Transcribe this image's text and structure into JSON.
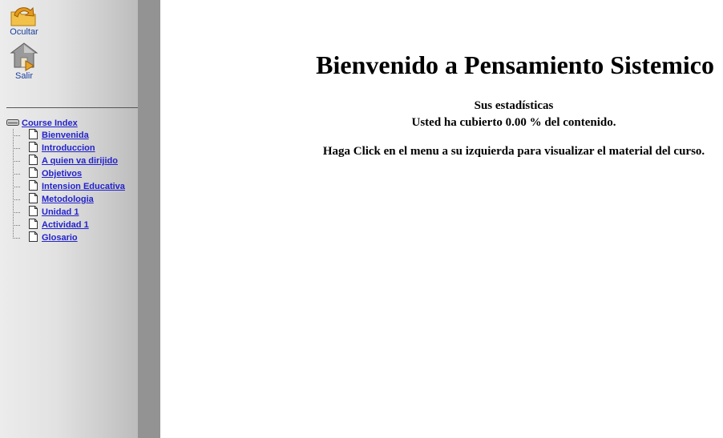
{
  "sidebar": {
    "tools": {
      "hide_label": "Ocultar",
      "exit_label": "Salir"
    },
    "tree": {
      "root_label": "Course Index",
      "items": [
        {
          "label": "Bienvenida"
        },
        {
          "label": "Introduccion"
        },
        {
          "label": "A quien va dirijido"
        },
        {
          "label": "Objetivos"
        },
        {
          "label": "Intension Educativa"
        },
        {
          "label": "Metodologia"
        },
        {
          "label": "Unidad 1"
        },
        {
          "label": "Actividad 1"
        },
        {
          "label": "Glosario"
        }
      ]
    }
  },
  "main": {
    "title": "Bienvenido a Pensamiento Sistemico",
    "stats_heading": "Sus estadísticas",
    "coverage_text": "Usted ha cubierto 0.00 % del contenido.",
    "instruction_text": "Haga Click en el menu a su izquierda para visualizar el material del curso."
  },
  "colors": {
    "link": "#2222cc",
    "sidebar_strip": "#939393"
  },
  "icons": [
    "folder-arrow-icon",
    "exit-house-icon",
    "drive-icon",
    "page-icon"
  ]
}
